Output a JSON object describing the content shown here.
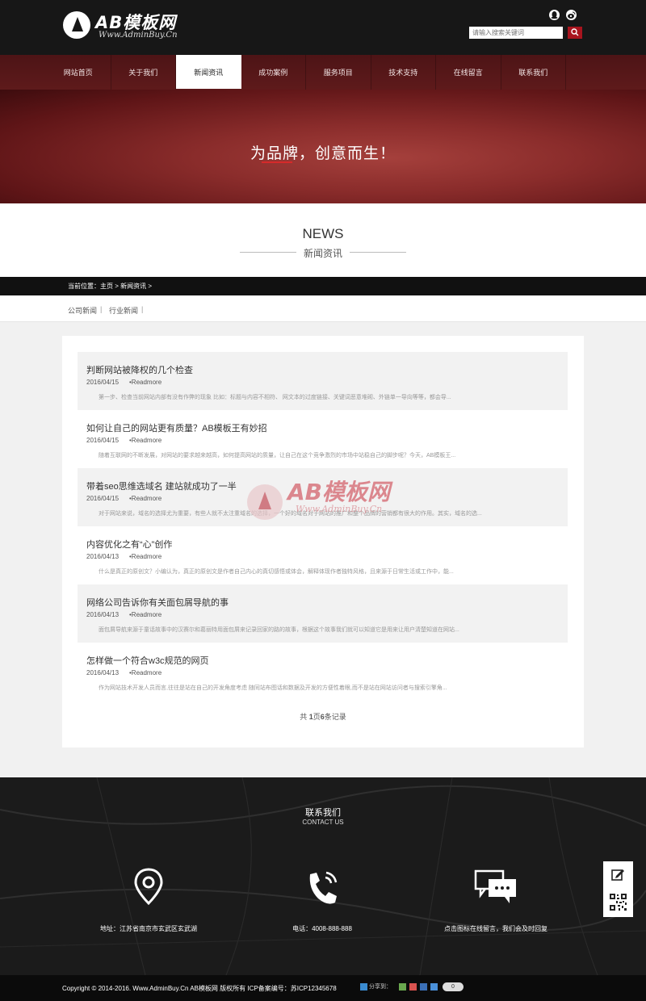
{
  "logo": {
    "name": "AB模板网",
    "url_text": "Www.AdminBuy.Cn"
  },
  "header": {
    "search_placeholder": "请输入搜索关键词",
    "social": [
      "qq-icon",
      "weibo-icon"
    ]
  },
  "nav": {
    "items": [
      {
        "label": "网站首页"
      },
      {
        "label": "关于我们"
      },
      {
        "label": "新闻资讯"
      },
      {
        "label": "成功案例"
      },
      {
        "label": "服务项目"
      },
      {
        "label": "技术支持"
      },
      {
        "label": "在线留言"
      },
      {
        "label": "联系我们"
      }
    ],
    "active": "新闻资讯"
  },
  "banner": {
    "slogan": "为品牌，创意而生！"
  },
  "section": {
    "title_en": "NEWS",
    "title_cn": "新闻资讯"
  },
  "breadcrumb": {
    "text": "当前位置：主页 > 新闻资讯 >"
  },
  "subtabs": [
    {
      "label": "公司新闻"
    },
    {
      "label": "行业新闻"
    }
  ],
  "news": [
    {
      "title": "判断网站被降权的几个检查",
      "date": "2016/04/15",
      "more": "•Readmore",
      "desc": "第一步、检查当前网站内部有没有作弊的现象 比如：标题与内容不相符、 网文本的过度链接、关键词恶意堆砌、外链单一导向等等，都会导..."
    },
    {
      "title": "如何让自己的网站更有质量？AB模板王有妙招",
      "date": "2016/04/15",
      "more": "•Readmore",
      "desc": "随着互联网的不断发展，对网站的要求越来越高，如何提高网站的质量，让自己在这个竞争激烈的市场中站稳自己的脚步呢？今天，AB模板王..."
    },
    {
      "title": "带着seo思维选域名 建站就成功了一半",
      "date": "2016/04/15",
      "more": "•Readmore",
      "desc": "对于网站来说，域名的选择尤为重要，有些人就不太注重域名的选择，一个好的域名对于网站的推广和整个品牌的营销都有很大的作用。其实，域名的选..."
    },
    {
      "title": "内容优化之有“心”创作",
      "date": "2016/04/13",
      "more": "•Readmore",
      "desc": "什么是真正的原创文？小编认为，真正的原创文是作者自己内心的真切感悟或体会，解释体现作者独特风格，且来源于日常生活或工作中，能..."
    },
    {
      "title": "网络公司告诉你有关面包屑导航的事",
      "date": "2016/04/13",
      "more": "•Readmore",
      "desc": "面包屑导航来源于童话故事中的汉赛尔和葛丽特用面包屑来记录回家的路的故事，根据这个故事我们就可以知道它是用来让用户清楚知道在网站..."
    },
    {
      "title": "怎样做一个符合w3c规范的网页",
      "date": "2016/04/13",
      "more": "•Readmore",
      "desc": "作为网站技术开发人员而言,往往是站在自己的开发角度考虑 随同站布图话和数据及开发的方便性着眼,而不是站在网站访问者与搜索引擎角..."
    }
  ],
  "pager": {
    "prefix": "共",
    "pages": "1",
    "mid": "页",
    "count": "6",
    "suffix": "条记录"
  },
  "watermark": {
    "name": "AB模板网",
    "url": "Www.AdminBuy.Cn"
  },
  "contact": {
    "title": "联系我们",
    "subtitle": "CONTACT US",
    "items": [
      {
        "icon": "location-pin-icon",
        "text": "地址：江苏省南京市玄武区玄武湖"
      },
      {
        "icon": "phone-icon",
        "text": "电话：4008-888-888"
      },
      {
        "icon": "chat-bubbles-icon",
        "text": "点击图标在线留言，我们会及时回复"
      }
    ]
  },
  "side": {
    "icons": [
      "edit-icon",
      "qr-code-icon"
    ]
  },
  "footer": {
    "copyright": "Copyright © 2014-2016. Www.AdminBuy.Cn AB模板网 版权所有 ICP备案编号：苏ICP12345678",
    "share_label": "分享到：",
    "share_count": "0"
  },
  "colors": {
    "header_bg": "#171717",
    "accent_red": "#a8141e",
    "nav_bg": "#5e1a1b",
    "footer_bg": "#0b0b0b"
  }
}
